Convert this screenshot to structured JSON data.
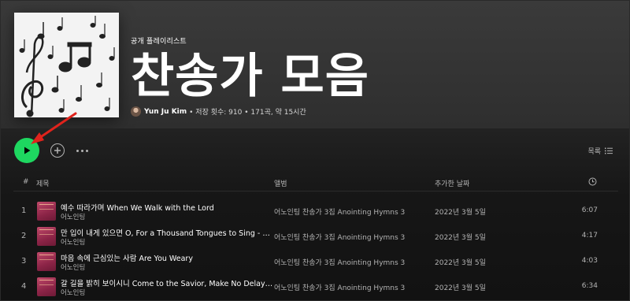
{
  "playlist": {
    "type_label": "공개 플레이리스트",
    "title": "찬송가 모음",
    "owner": "Yun Ju Kim",
    "stats": "• 저장 횟수: 910 • 171곡, 약 15시간"
  },
  "controls": {
    "view_label": "목록"
  },
  "table": {
    "headers": {
      "num": "#",
      "title": "제목",
      "album": "앨범",
      "date_added": "추가한 날짜"
    },
    "rows": [
      {
        "num": "1",
        "title": "예수 따라가며 When We Walk with the Lord",
        "artist": "어노인팅",
        "album": "어노인팅 찬송가 3집 Anointing Hymns 3",
        "date": "2022년 3월 5일",
        "duration": "6:07"
      },
      {
        "num": "2",
        "title": "만 입이 내게 있으면 O, For a Thousand Tongues to Sing - 찬양",
        "artist": "어노인팅",
        "album": "어노인팅 찬송가 3집 Anointing Hymns 3",
        "date": "2022년 3월 5일",
        "duration": "4:17"
      },
      {
        "num": "3",
        "title": "마음 속에 근심있는 사람 Are You Weary",
        "artist": "어노인팅",
        "album": "어노인팅 찬송가 3집 Anointing Hymns 3",
        "date": "2022년 3월 5일",
        "duration": "4:03"
      },
      {
        "num": "4",
        "title": "갈 길을 밝히 보이시니 Come to the Savior, Make No Delay - 내",
        "artist": "어노인팅",
        "album": "어노인팅 찬송가 3집 Anointing Hymns 3",
        "date": "2022년 3월 5일",
        "duration": "6:34"
      }
    ]
  },
  "colors": {
    "accent": "#1ed760",
    "annotation_arrow": "#e0231c"
  }
}
